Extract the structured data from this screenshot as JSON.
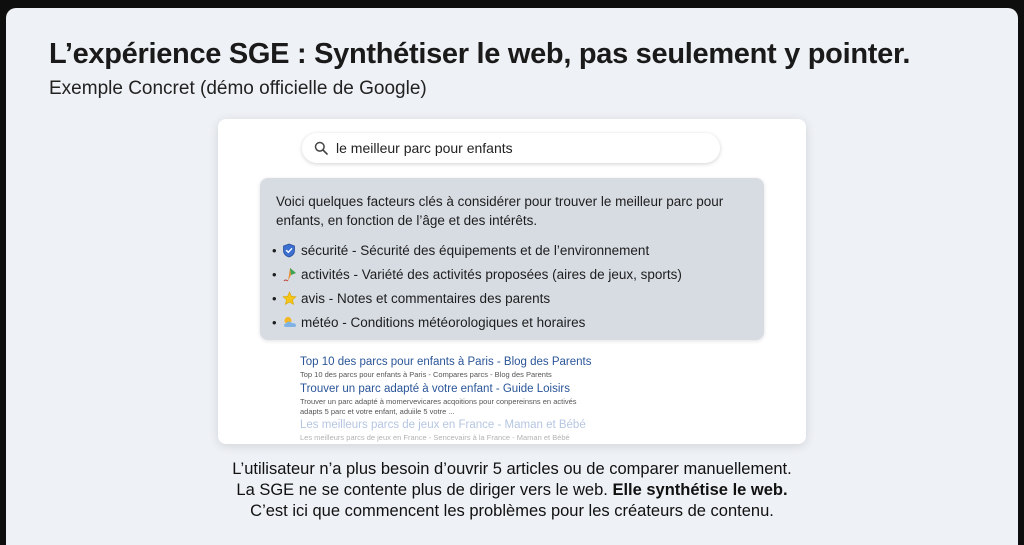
{
  "title": "L’expérience SGE : Synthétiser le web, pas seulement y pointer.",
  "subtitle": "Exemple Concret (démo officielle de Google)",
  "search": {
    "query": "le meilleur parc pour enfants",
    "icon": "search-icon"
  },
  "ai_overview": {
    "intro": "Voici quelques facteurs clés à considérer pour trouver le meilleur parc pour enfants, en fonction de l’âge et des intérêts.",
    "items": [
      {
        "icon": "shield-icon",
        "text": "sécurité - Sécurité des équipements et de l’environnement"
      },
      {
        "icon": "kite-icon",
        "text": "activités - Variété des activités proposées (aires de jeux, sports)"
      },
      {
        "icon": "star-icon",
        "text": "avis - Notes et commentaires des parents"
      },
      {
        "icon": "weather-icon",
        "text": "météo - Conditions météorologiques et horaires"
      }
    ],
    "bullet": "•"
  },
  "results": [
    {
      "title": "Top 10 des parcs pour enfants à Paris - Blog des Parents",
      "snippet_lines": [
        "Top 10 des parcs pour enfants à Paris - Compares parcs - Blog des Parents"
      ]
    },
    {
      "title": "Trouver un parc adapté à votre enfant - Guide Loisirs",
      "snippet_lines": [
        "Trouver un parc adapté à momervevicares acqoitions pour conpereinsns en activés",
        "adapts 5 parc et votre enfant, aduiile 5 votre ..."
      ]
    },
    {
      "title": "Les meilleurs parcs de jeux en France - Maman et Bébé",
      "snippet_lines": [
        "Les meilleurs parcs de jeux en France - Sencevairs à la France - Maman et Bébé"
      ]
    }
  ],
  "caption": {
    "line1": "L’utilisateur n’a plus besoin d’ouvrir 5 articles ou de comparer manuellement.",
    "line2_plain": "La SGE ne se contente plus de diriger vers le web. ",
    "line2_bold": "Elle synthétise le web.",
    "line3": "C’est ici que commencent les problèmes pour les créateurs de contenu."
  },
  "colors": {
    "slide_bg": "#eef1f5",
    "panel_bg": "#d7dce3",
    "link": "#2a5598"
  }
}
